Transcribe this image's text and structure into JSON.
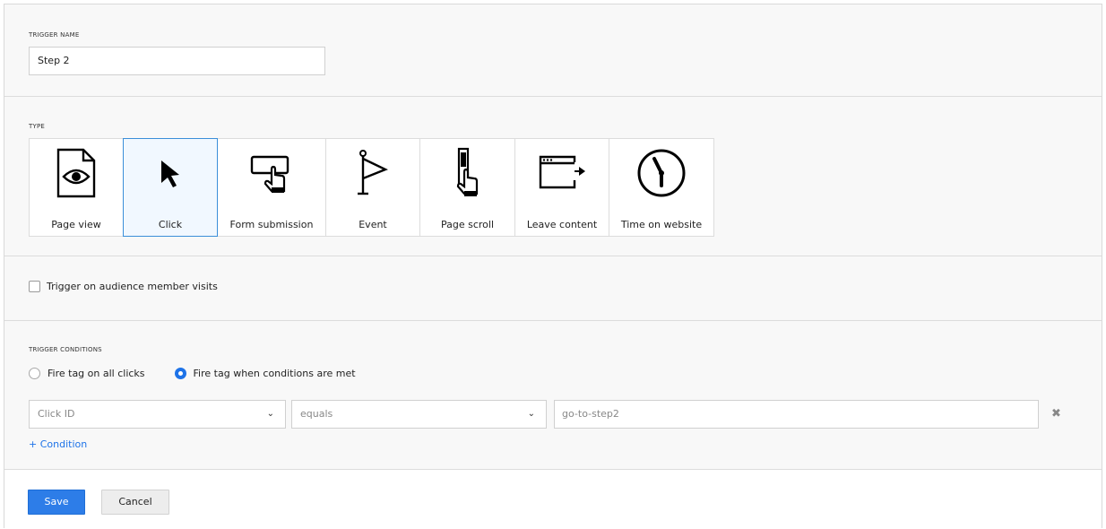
{
  "trigger_name": {
    "label": "TRIGGER NAME",
    "value": "Step 2"
  },
  "type": {
    "label": "TYPE",
    "options": [
      {
        "label": "Page view",
        "icon": "page-view-icon"
      },
      {
        "label": "Click",
        "icon": "cursor-icon",
        "selected": true
      },
      {
        "label": "Form submission",
        "icon": "form-submission-icon"
      },
      {
        "label": "Event",
        "icon": "flag-icon"
      },
      {
        "label": "Page scroll",
        "icon": "scroll-icon"
      },
      {
        "label": "Leave content",
        "icon": "leave-content-icon"
      },
      {
        "label": "Time on website",
        "icon": "clock-icon"
      }
    ]
  },
  "audience": {
    "checkbox_label": "Trigger on audience member visits",
    "checked": false
  },
  "conditions": {
    "label": "TRIGGER CONDITIONS",
    "radio_all": "Fire tag on all clicks",
    "radio_conditions": "Fire tag when conditions are met",
    "selected": "conditions",
    "row": {
      "field": "Click ID",
      "operator": "equals",
      "value_placeholder": "go-to-step2"
    },
    "add_label": "+ Condition"
  },
  "footer": {
    "save_label": "Save",
    "cancel_label": "Cancel"
  },
  "colors": {
    "accent": "#2d7de8",
    "selected_bg": "#f1f8ff",
    "selected_border": "#3b8fd9"
  }
}
